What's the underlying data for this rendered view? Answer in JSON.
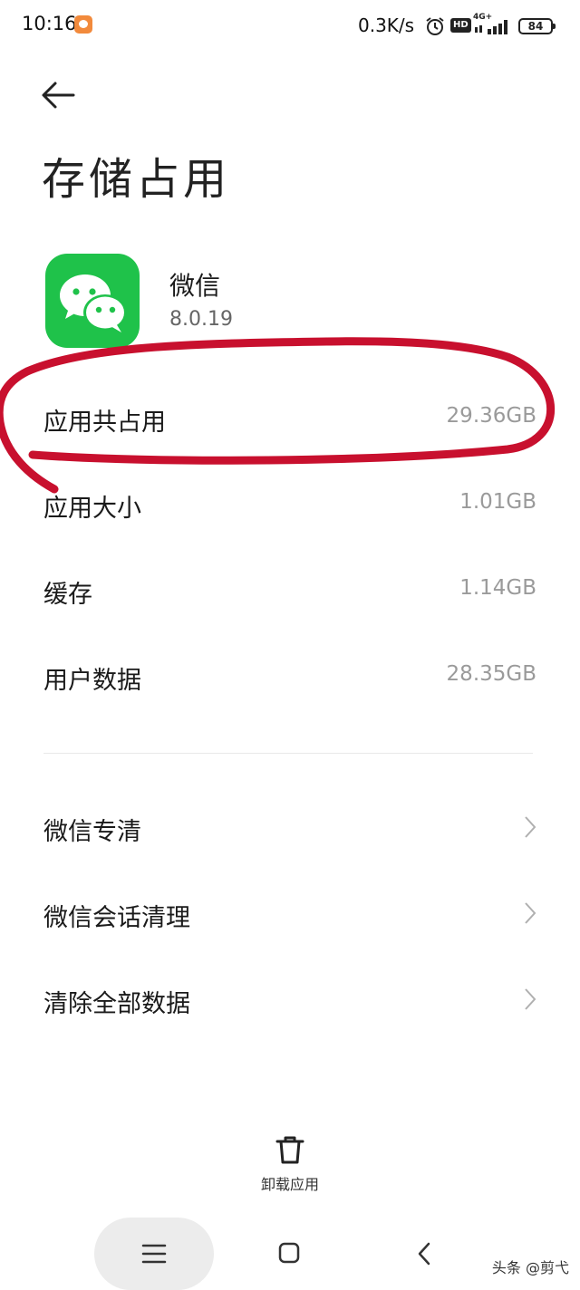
{
  "status_bar": {
    "time": "10:16",
    "network_speed": "0.3K/s",
    "hd_badge": "HD",
    "network_type": "4G+",
    "battery": "84"
  },
  "header": {
    "title": "存储占用"
  },
  "app": {
    "name": "微信",
    "version": "8.0.19",
    "icon": "wechat-logo",
    "icon_color": "#1fc24a"
  },
  "storage": [
    {
      "label": "应用共占用",
      "value": "29.36GB"
    },
    {
      "label": "应用大小",
      "value": "1.01GB"
    },
    {
      "label": "缓存",
      "value": "1.14GB"
    },
    {
      "label": "用户数据",
      "value": "28.35GB"
    }
  ],
  "actions": [
    {
      "label": "微信专清"
    },
    {
      "label": "微信会话清理"
    },
    {
      "label": "清除全部数据"
    }
  ],
  "bottom_action": {
    "label": "卸载应用",
    "icon": "trash-icon"
  },
  "annotation": {
    "color": "#c8102e"
  },
  "watermark": "头条 @剪弋"
}
